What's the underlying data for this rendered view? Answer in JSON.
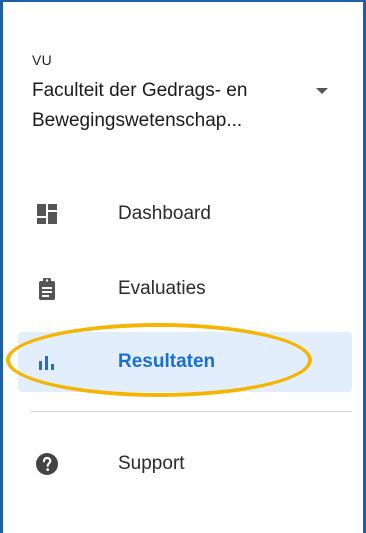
{
  "header": {
    "org": "VU",
    "faculty_line1": "Faculteit der Gedrags- en",
    "faculty_line2": "Bewegingswetenschap..."
  },
  "nav": {
    "items": [
      {
        "label": "Dashboard",
        "icon": "dashboard-icon"
      },
      {
        "label": "Evaluaties",
        "icon": "clipboard-icon"
      },
      {
        "label": "Resultaten",
        "icon": "bar-chart-icon",
        "active": true
      },
      {
        "label": "Support",
        "icon": "help-circle-icon"
      }
    ]
  },
  "colors": {
    "accent": "#1a6fd4",
    "active_bg": "#e3eefc",
    "highlight": "#f4b400",
    "frame": "#1f5fa6"
  }
}
